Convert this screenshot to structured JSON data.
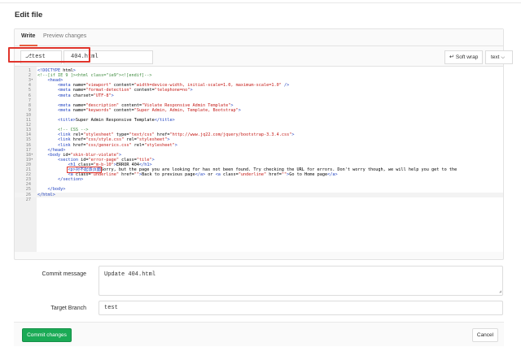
{
  "page": {
    "title": "Edit file"
  },
  "tabs": {
    "write": "Write",
    "preview": "Preview changes"
  },
  "file": {
    "branch_label": "test",
    "filename": "404.html",
    "soft_wrap_label": "Soft wrap",
    "mode_label": "text"
  },
  "icons": {
    "branch": "git-branch-icon",
    "wrap": "wrap-icon",
    "chevron": "chevron-down-icon"
  },
  "code_lines": [
    "<!DOCTYPE html>",
    "<!--[if IE 9 ]><html class=\"ie9\"><![endif]-->",
    "    <head>",
    "        <meta name=\"viewport\" content=\"width=device-width, initial-scale=1.0, maximum-scale=1.0\" />",
    "        <meta name=\"format-detection\" content=\"telephone=no\">",
    "        <meta charset=\"UTF-8\">",
    "",
    "        <meta name=\"description\" content=\"Violate Responsive Admin Template\">",
    "        <meta name=\"keywords\" content=\"Super Admin, Admin, Template, Bootstrap\">",
    "",
    "        <title>Super Admin Responsive Template</title>",
    "",
    "        <!-- CSS -->",
    "        <link rel=\"stylesheet\" type=\"text/css\" href=\"http://www.jq22.com/jquery/bootstrap-3.3.4.css\">",
    "        <link href=\"css/style.css\" rel=\"stylesheet\">",
    "        <link href=\"css/generics.css\" rel=\"stylesheet\">",
    "    </head>",
    "    <body id=\"skin-blur-violate\">",
    "        <section id=\"error-page\" class=\"tile\">",
    "            <h1 class=\"m-b-10\">ERROR 404</h1>",
    "            <p>对不起该页面Sorry, but the page you are looking for has not been found. Try checking the URL for errors. Don't worry though, we will help you get to the",
    "            <a class=\"underline\" href=\"\">Back to previous page</a> or <a class=\"underline\" href=\"\">Go to Home page</a>",
    "        </section>",
    "",
    "    </body>",
    "</html>",
    ""
  ],
  "fold_lines": [
    3,
    18,
    19
  ],
  "commit": {
    "message_label": "Commit message",
    "message_value": "Update 404.html",
    "target_branch_label": "Target Branch",
    "target_branch_value": "test"
  },
  "actions": {
    "commit_label": "Commit changes",
    "cancel_label": "Cancel"
  },
  "colors": {
    "accent_green": "#1aaa55",
    "highlight_red": "#e0342b",
    "active_tab": "#e75e40"
  }
}
